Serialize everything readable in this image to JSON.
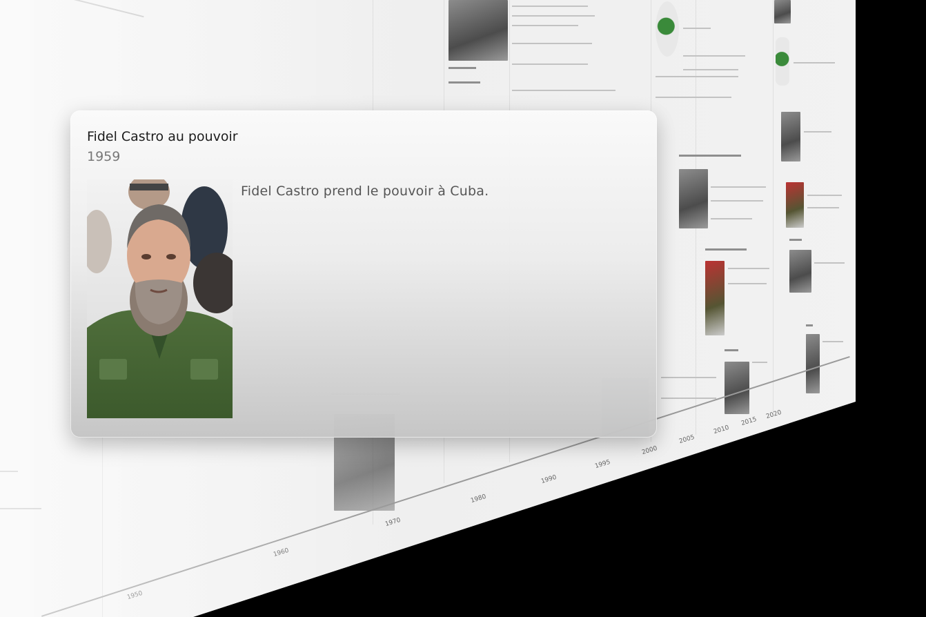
{
  "popover": {
    "title": "Fidel Castro au pouvoir",
    "year": "1959",
    "description": "Fidel Castro prend le pouvoir à Cuba.",
    "image_icon": "portrait-photo"
  },
  "timeline": {
    "axis_ticks": [
      "1950",
      "1960",
      "1970",
      "1980",
      "1990",
      "1995",
      "2000",
      "2005",
      "2010",
      "2015",
      "2020"
    ]
  },
  "colors": {
    "card_top": "#fafafa",
    "card_bottom": "#c4c4c4",
    "title": "#1c1c1c",
    "year": "#777777",
    "description": "#555555"
  }
}
